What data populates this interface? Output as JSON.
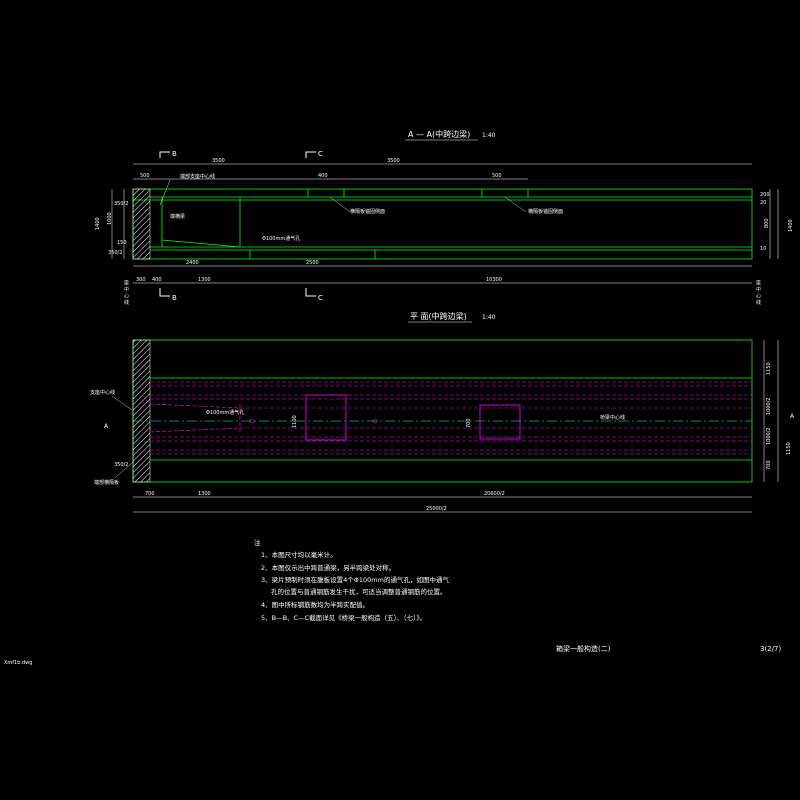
{
  "titles": {
    "elevation": "A — A(中跨边梁)",
    "elevation_scale": "1:40",
    "plan": "平 面(中跨边梁)",
    "plan_scale": "1:40"
  },
  "section_marks": {
    "b_top": "B",
    "c_top": "C",
    "b_bottom": "B",
    "c_bottom": "C",
    "a_left": "A",
    "a_right": "A"
  },
  "elevation_dims": {
    "top_3500_left": "3500",
    "top_3500_right": "3500",
    "top_500_left": "500",
    "top_400": "400",
    "top_500_right": "500",
    "bottom_2400": "2400",
    "bottom_2500": "2500",
    "bottom_300": "300",
    "bottom_400": "400",
    "bottom_1300": "1300",
    "bottom_10300": "10300",
    "left_1400": "1400",
    "left_1000": "1000",
    "left_350_2_top": "350/2",
    "left_350_2_bot": "350/2",
    "left_150": "150",
    "right_800": "800",
    "right_1400": "1400",
    "right_200": "200",
    "right_20": "20",
    "right_10": "10"
  },
  "elevation_labels": {
    "bearing_center": "端部支座中心线",
    "diaphragm": "端横梁",
    "vent_hole": "Φ100mm通气孔",
    "diaphragm_face_left": "横隔板锚固侧面",
    "diaphragm_face_right": "横隔板锚固侧面"
  },
  "side_vertical_text": "梁 中 心 线",
  "plan_labels": {
    "bearing_center": "支座中心线",
    "end_diaphragm": "端部横隔板",
    "vent_hole": "Φ100mm通气孔",
    "beam_center": "桥梁中心线",
    "dim_1100": "1100",
    "dim_700": "700",
    "left_350_2": "350/2"
  },
  "plan_dims": {
    "bottom_700": "700",
    "bottom_1300": "1300",
    "bottom_20600_2": "20600/2",
    "total_25000_2": "25000/2",
    "right_1150": "1150",
    "right_1000_2_top": "1000/2",
    "right_1000_2_bot": "1000/2",
    "right_700": "700",
    "right_1150_bot": "1150"
  },
  "notes": {
    "heading": "注",
    "items": [
      "1、本图尺寸均以毫米计。",
      "2、本图仅示出中跨普通梁，另半跨梁处对称。",
      "3、梁片预制时须在腹板设置4个Φ100mm的通气孔，如图中通气",
      "孔的位置与普通钢筋发生干扰，可适当调整普通钢筋的位置。",
      "4、图中所标钢筋数均为半跨实配值。",
      "5、B—B、C—C截面详见《桥梁一般构造（五）、（七）》。"
    ]
  },
  "footer": {
    "drawing_title": "箱梁一般构造(二)",
    "sheet": "3(2/7)",
    "filename": "Xmf1b.dwg"
  },
  "colors": {
    "green": "#00ff00",
    "white": "#ffffff",
    "magenta": "#ff00ff",
    "cyan": "#00ffff",
    "background": "#000000"
  }
}
